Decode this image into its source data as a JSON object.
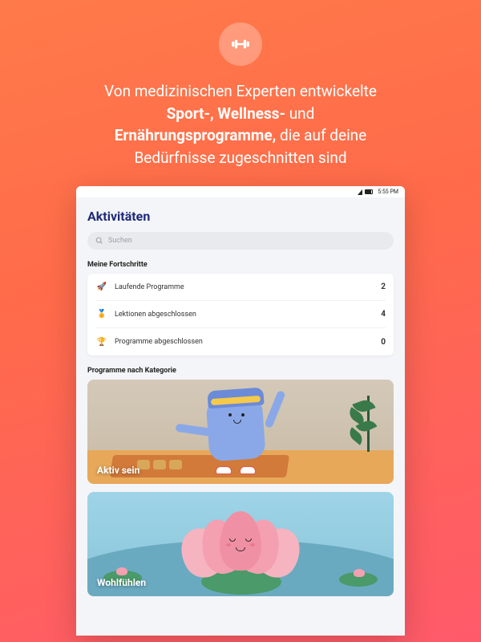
{
  "hero": {
    "line1a": "Von medizinischen Experten entwickelte",
    "line2_bold": "Sport-, Wellness-",
    "line2_rest": " und",
    "line3_bold": "Ernährungsprogramme,",
    "line3_rest": " die auf deine",
    "line4": "Bedürfnisse zugeschnitten sind"
  },
  "status": {
    "time": "5:55 PM"
  },
  "app": {
    "title": "Aktivitäten",
    "search_placeholder": "Suchen",
    "progress_section": "Meine Fortschritte",
    "progress": [
      {
        "icon": "🚀",
        "label": "Laufende Programme",
        "value": "2"
      },
      {
        "icon": "🏅",
        "label": "Lektionen abgeschlossen",
        "value": "4"
      },
      {
        "icon": "🏆",
        "label": "Programme abgeschlossen",
        "value": "0"
      }
    ],
    "category_section": "Programme nach Kategorie",
    "categories": [
      {
        "title": "Aktiv sein"
      },
      {
        "title": "Wohlfühlen"
      }
    ]
  }
}
